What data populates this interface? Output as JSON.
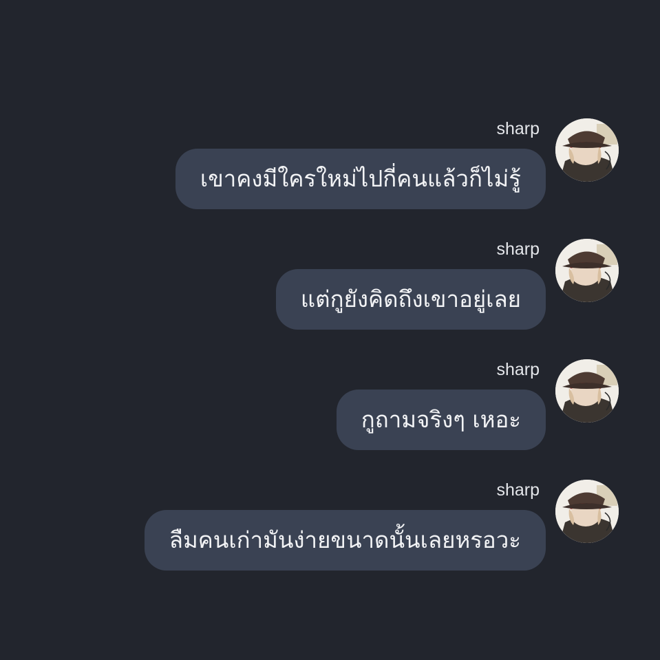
{
  "colors": {
    "background": "#22252d",
    "bubble": "#3a4253",
    "bubble_text": "#f2f3f5",
    "sender_text": "#e4e6ea"
  },
  "messages": [
    {
      "sender": "sharp",
      "text": "เขาคงมีใครใหม่ไปกี่คนแล้วก็ไม่รู้",
      "avatar_icon": "character-avatar-icon"
    },
    {
      "sender": "sharp",
      "text": "แต่กูยังคิดถึงเขาอยู่เลย",
      "avatar_icon": "character-avatar-icon"
    },
    {
      "sender": "sharp",
      "text": "กูถามจริงๆ เหอะ",
      "avatar_icon": "character-avatar-icon"
    },
    {
      "sender": "sharp",
      "text": "ลืมคนเก่ามันง่ายขนาดนั้นเลยหรอวะ",
      "avatar_icon": "character-avatar-icon"
    }
  ]
}
